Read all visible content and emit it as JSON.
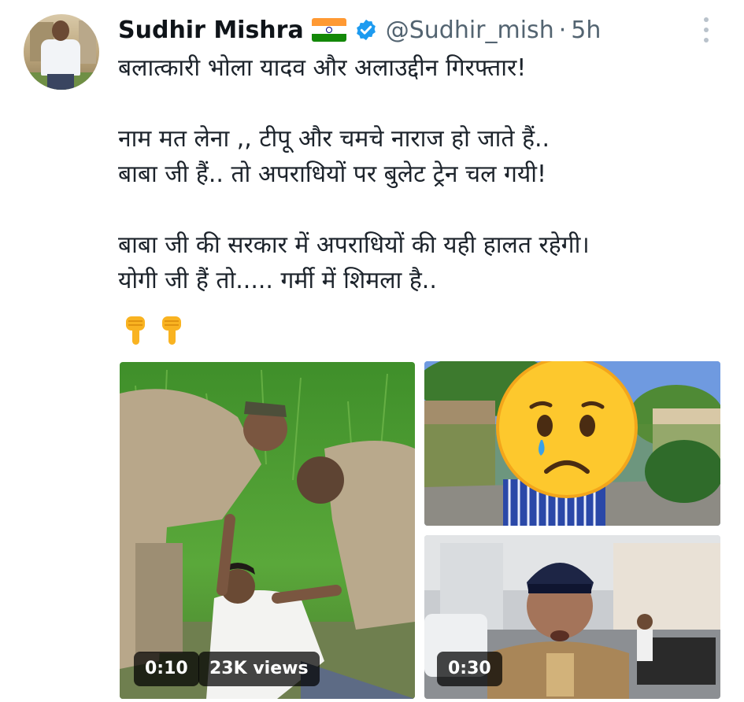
{
  "author": {
    "name": "Sudhir Mishra",
    "handle": "@Sudhir_mish",
    "separator": "·",
    "time": "5h",
    "badges": [
      "india-flag-emoji",
      "verified-badge-icon"
    ],
    "accent_color": "#1d9bf0"
  },
  "tweet": {
    "lines": [
      "बलात्कारी भोला यादव और अलाउद्दीन गिरफ्तार!",
      "",
      "नाम मत लेना ,, टीपू और चमचे नाराज हो जाते हैं..",
      "बाबा जी हैं.. तो अपराधियों पर बुलेट ट्रेन चल गयी!",
      "",
      "बाबा जी की सरकार में अपराधियों की यही हालत रहेगी।",
      "योगी जी हैं तो..... गर्मी में शिमला है.."
    ],
    "emojis": [
      "point-down-emoji",
      "point-down-emoji"
    ]
  },
  "media": {
    "video1": {
      "duration": "0:10",
      "views": "23K views"
    },
    "video2": {
      "duration": "0:30"
    },
    "image_overlay_emoji": "crying-face-emoji"
  }
}
